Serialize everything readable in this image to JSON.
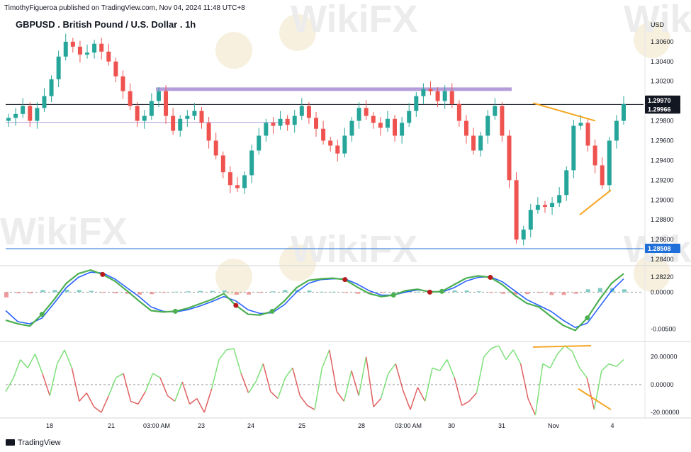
{
  "header": {
    "publisher_note": "TimothyFigueroa published on TradingView.com, Nov 04, 2024 11:48 UTC+8",
    "symbol_title": "GBPUSD . British Pound / U.S. Dollar . 1h",
    "currency_unit": "USD"
  },
  "footer": {
    "brand": "TradingView"
  },
  "watermark": "WikiFX",
  "colors": {
    "up": "#26a69a",
    "down": "#ef5350",
    "purple": "#b39ddb",
    "orange": "#f5a623",
    "blue_line": "#2962ff",
    "green_line": "#4caf50",
    "dark_red": "#b71c1c"
  },
  "chart_data": [
    {
      "type": "candlestick",
      "title": "GBPUSD . British Pound / U.S. Dollar . 1h",
      "y_unit": "USD",
      "ylim": [
        1.2835,
        1.3085
      ],
      "y_ticks": [
        "1.30600",
        "1.30400",
        "1.30200",
        "1.29800",
        "1.29600",
        "1.29400",
        "1.29200",
        "1.29000",
        "1.28800",
        "1.28600",
        "1.28400",
        "1.28220"
      ],
      "price_labels": [
        {
          "text": "1.29970",
          "value": 1.2997,
          "color": "#131722"
        },
        {
          "text": "1.29966",
          "value": 1.29966,
          "color": "#131722"
        },
        {
          "text": "1.28508",
          "value": 1.28508,
          "color": "#1e6fd9"
        }
      ],
      "x_ticks": [
        "18",
        "21",
        "03:00 AM",
        "23",
        "24",
        "25",
        "28",
        "03:00 AM",
        "30",
        "31",
        "Nov",
        "4"
      ],
      "horizontal_lines": [
        {
          "value": 1.29966,
          "color": "#131722"
        },
        {
          "value": 1.29785,
          "color": "#b39ddb"
        },
        {
          "value": 1.28508,
          "color": "#1e6fd9"
        }
      ],
      "resistance_zone": {
        "from_tick": "21",
        "to_tick": "31",
        "value": 1.3012
      },
      "series": [
        {
          "values": [
            1.2983,
            1.2987,
            1.2995,
            1.298,
            1.2993,
            1.3005,
            1.3022,
            1.3045,
            1.306,
            1.3055,
            1.3047,
            1.3049,
            1.3058,
            1.305,
            1.304,
            1.3025,
            1.301,
            1.2995,
            1.298,
            1.2985,
            1.3,
            1.301,
            1.2985,
            1.297,
            1.2982,
            1.2985,
            1.299,
            1.2978,
            1.296,
            1.2945,
            1.2928,
            1.2915,
            1.2912,
            1.2925,
            1.295,
            1.2965,
            1.2978,
            1.2975,
            1.2982,
            1.2976,
            1.2985,
            1.2995,
            1.2983,
            1.2972,
            1.296,
            1.2955,
            1.2947,
            1.2965,
            1.298,
            1.2993,
            1.2985,
            1.2978,
            1.2973,
            1.2982,
            1.2965,
            1.2978,
            1.299,
            1.3005,
            1.3012,
            1.301,
            1.3,
            1.301,
            1.2997,
            1.298,
            1.2965,
            1.295,
            1.2965,
            1.2985,
            1.2995,
            1.2965,
            1.292,
            1.286,
            1.287,
            1.289,
            1.2895,
            1.2893,
            1.2897,
            1.2905,
            1.293,
            1.2975,
            1.2978,
            1.2955,
            1.2935,
            1.2915,
            1.296,
            1.298,
            1.2997
          ]
        }
      ],
      "annotations": [
        {
          "type": "trendline",
          "color": "#f5a623",
          "points": [
            [
              "31",
              1.2998
            ],
            [
              "Nov",
              1.298
            ]
          ]
        },
        {
          "type": "trendline",
          "color": "#f5a623",
          "points": [
            [
              "Nov",
              1.2885
            ],
            [
              "4",
              1.291
            ]
          ]
        }
      ]
    },
    {
      "type": "line",
      "ylim": [
        -0.0065,
        0.0033
      ],
      "y_ticks": [
        "0.00000",
        "-0.00500"
      ],
      "series": [
        {
          "color": "#4caf50",
          "values": [
            -0.0038,
            -0.0043,
            -0.0046,
            -0.003,
            -0.001,
            0.0012,
            0.0025,
            0.003,
            0.0024,
            0.0015,
            0.0002,
            -0.0012,
            -0.0025,
            -0.0027,
            -0.0026,
            -0.0022,
            -0.0016,
            -0.001,
            -0.0002,
            -0.0018,
            -0.003,
            -0.0031,
            -0.0026,
            -0.0012,
            0.0006,
            0.0016,
            0.0018,
            0.0019,
            0.0017,
            0.0007,
            -0.0002,
            -0.0006,
            -0.0004,
            0.0002,
            0.0004,
            0.0,
            0.0001,
            0.001,
            0.0019,
            0.0022,
            0.002,
            0.001,
            -0.0004,
            -0.0015,
            -0.002,
            -0.0033,
            -0.0045,
            -0.0052,
            -0.0035,
            -0.001,
            0.0012,
            0.0025
          ]
        },
        {
          "color": "#2962ff",
          "values": [
            -0.0025,
            -0.004,
            -0.0043,
            -0.0035,
            -0.0015,
            0.0006,
            0.002,
            0.0027,
            0.0026,
            0.0018,
            0.0006,
            -0.0006,
            -0.002,
            -0.0026,
            -0.0027,
            -0.0024,
            -0.0019,
            -0.0013,
            -0.0006,
            -0.0012,
            -0.0024,
            -0.0029,
            -0.0028,
            -0.0017,
            0.0,
            0.0012,
            0.0017,
            0.0018,
            0.0018,
            0.0011,
            0.0002,
            -0.0004,
            -0.0004,
            0.0,
            0.0003,
            0.0001,
            0.0,
            0.0006,
            0.0015,
            0.002,
            0.0021,
            0.0014,
            0.0002,
            -0.001,
            -0.0018,
            -0.0026,
            -0.0038,
            -0.0048,
            -0.0042,
            -0.002,
            0.0002,
            0.0018
          ]
        }
      ]
    },
    {
      "type": "line",
      "ylim": [
        -23,
        29
      ],
      "y_ticks": [
        "20.00000",
        "0.00000",
        "-20.00000"
      ],
      "series": [
        {
          "values": [
            -5,
            4,
            18,
            12,
            22,
            8,
            -8,
            15,
            25,
            12,
            -12,
            -6,
            -16,
            -20,
            -8,
            5,
            8,
            -12,
            -14,
            -5,
            8,
            5,
            -8,
            -12,
            2,
            -14,
            -10,
            -20,
            -3,
            18,
            25,
            26,
            8,
            -6,
            2,
            15,
            -5,
            -10,
            5,
            12,
            -8,
            -15,
            -18,
            12,
            25,
            -5,
            -12,
            10,
            -8,
            20,
            -16,
            -10,
            8,
            15,
            -4,
            -18,
            -2,
            -12,
            12,
            10,
            18,
            5,
            -15,
            -12,
            -6,
            20,
            26,
            28,
            18,
            25,
            15,
            -10,
            -22,
            15,
            12,
            22,
            28,
            24,
            12,
            5,
            -18,
            10,
            15,
            13,
            18
          ]
        }
      ],
      "annotations": [
        {
          "type": "trendline",
          "color": "#f5a623",
          "points": [
            [
              "31",
              27
            ],
            [
              "Nov",
              28
            ]
          ]
        },
        {
          "type": "trendline",
          "color": "#f5a623",
          "points": [
            [
              "Nov",
              -3
            ],
            [
              "4",
              -18
            ]
          ]
        }
      ]
    }
  ]
}
